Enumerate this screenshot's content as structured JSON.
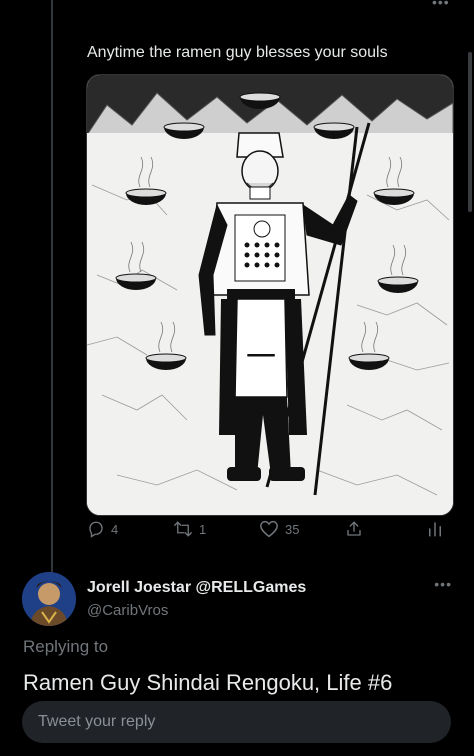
{
  "tweet": {
    "text": "Anytime the ramen guy blesses your souls",
    "image": {
      "alt_name": "ramen-guy-illustration",
      "apron_glyph": "一"
    },
    "actions": {
      "reply_count": "4",
      "retweet_count": "1",
      "like_count": "35"
    }
  },
  "reply": {
    "display_name": "Jorell Joestar @RELLGames",
    "handle": "@CaribVros",
    "replying_label": "Replying to",
    "replying_target": "Ramen Guy Shindai Rengoku, Life #6",
    "input_placeholder": "Tweet your reply"
  },
  "icons": {
    "more": "more-horizontal-icon",
    "reply": "reply-bubble-icon",
    "retweet": "retweet-icon",
    "like": "heart-icon",
    "share": "share-icon",
    "analytics": "analytics-bars-icon"
  },
  "colors": {
    "background": "#000000",
    "text_primary": "#e7e9ea",
    "text_secondary": "#71767b",
    "input_bg": "#202327"
  }
}
